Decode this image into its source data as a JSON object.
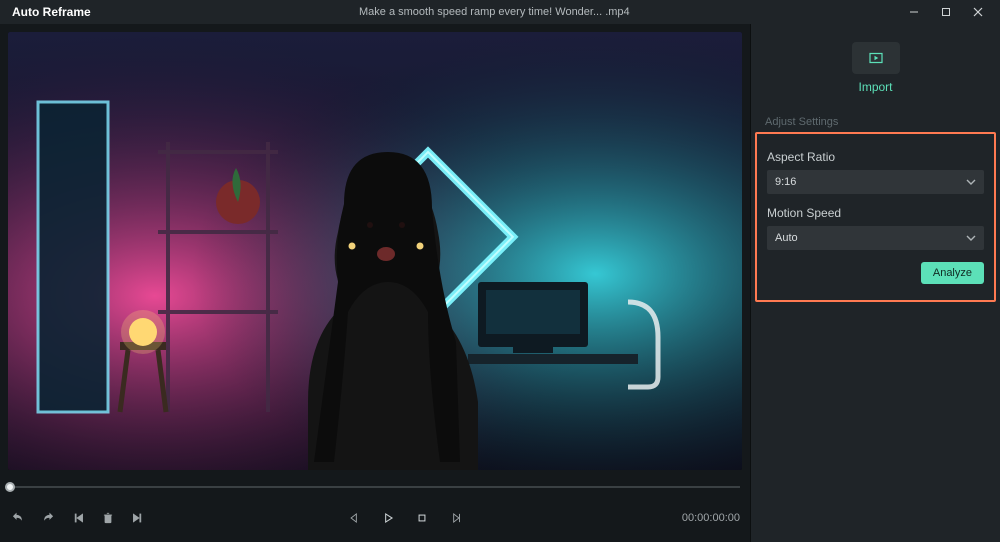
{
  "titlebar": {
    "app_title": "Auto Reframe",
    "file_title": "Make a smooth speed ramp every time!  Wonder... .mp4"
  },
  "transport": {
    "timecode": "00:00:00:00"
  },
  "side": {
    "import_label": "Import",
    "settings_header": "Adjust Settings",
    "aspect_ratio_label": "Aspect Ratio",
    "aspect_ratio_value": "9:16",
    "motion_speed_label": "Motion Speed",
    "motion_speed_value": "Auto",
    "analyze_label": "Analyze"
  }
}
